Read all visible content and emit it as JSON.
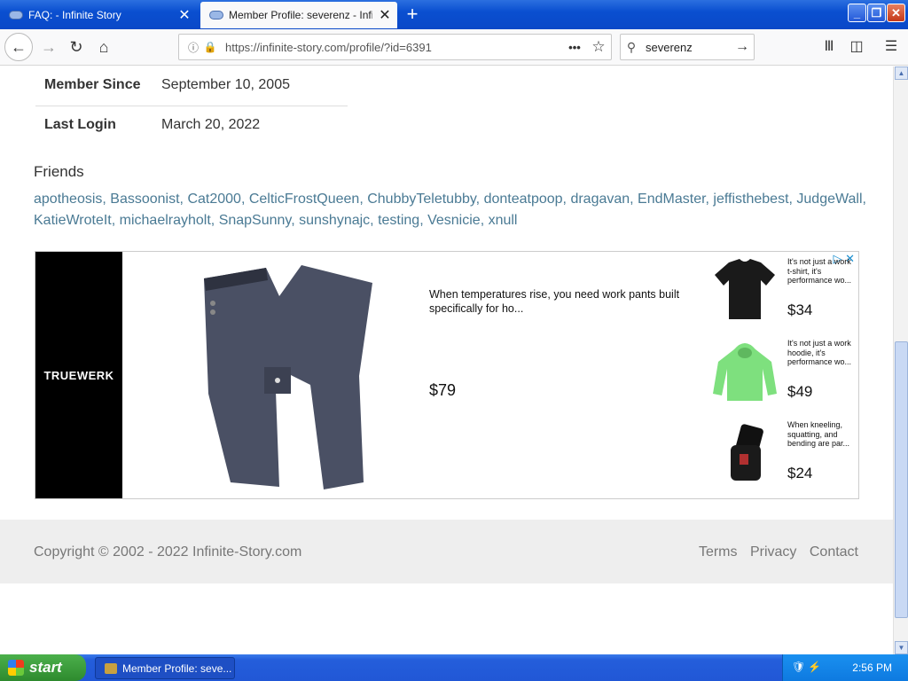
{
  "browser": {
    "tabs": [
      {
        "title": "FAQ: - Infinite Story",
        "active": false
      },
      {
        "title": "Member Profile: severenz - Infinite",
        "active": true
      }
    ],
    "url": "https://infinite-story.com/profile/?id=6391",
    "search_query": "severenz"
  },
  "profile": {
    "member_since_label": "Member Since",
    "member_since_value": "September 10, 2005",
    "last_login_label": "Last Login",
    "last_login_value": "March 20, 2022",
    "friends_title": "Friends",
    "friends": [
      "apotheosis",
      "Bassoonist",
      "Cat2000",
      "CelticFrostQueen",
      "ChubbyTeletubby",
      "donteatpoop",
      "dragavan",
      "EndMaster",
      "jeffisthebest",
      "JudgeWall",
      "KatieWroteIt",
      "michaelrayholt",
      "SnapSunny",
      "sunshynajc",
      "testing",
      "Vesnicie",
      "xnull"
    ]
  },
  "ad": {
    "brand": "TRUEWERK",
    "description": "When temperatures rise, you need work pants built specifically for ho...",
    "price": "$79",
    "products": [
      {
        "desc": "It's not just a work t-shirt, it's performance wo...",
        "price": "$34",
        "color": "#1a1a1a"
      },
      {
        "desc": "It's not just a work hoodie, it's performance wo...",
        "price": "$49",
        "color": "#7ee07e"
      },
      {
        "desc": "When kneeling, squatting, and bending are par...",
        "price": "$24",
        "color": "#111111"
      }
    ]
  },
  "footer": {
    "copyright": "Copyright © 2002 - 2022 Infinite-Story.com",
    "links": [
      "Terms",
      "Privacy",
      "Contact"
    ]
  },
  "taskbar": {
    "start_label": "start",
    "task_label": "Member Profile: seve...",
    "clock": "2:56 PM"
  }
}
